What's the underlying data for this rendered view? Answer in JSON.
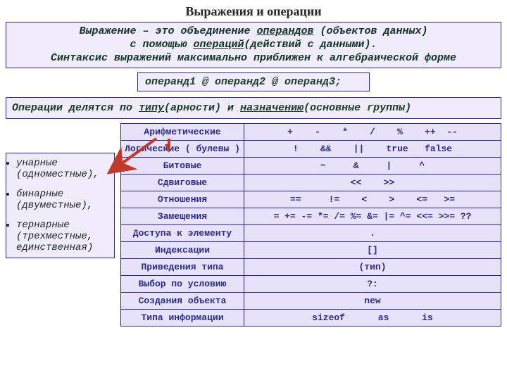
{
  "title": "Выражения и операции",
  "definition": {
    "line1_pre": "Выражение – это объединение ",
    "line1_u": "операндов",
    "line1_post": " (объектов данных)",
    "line2_pre": "с помощью ",
    "line2_u": "операций",
    "line2_post": "(действий с данными).",
    "line3": "Синтаксис выражений максимально приближен к алгебраической форме"
  },
  "syntax": "операнд1 @ операнд2 @ операнд3;",
  "types": {
    "pre1": "Операции  делятся по ",
    "u1": "типу",
    "mid1": "(арности) и ",
    "u2": "назначению",
    "post1": "(основные группы)"
  },
  "arity": {
    "items": [
      {
        "main": "унарные",
        "sub": "(одноместные),"
      },
      {
        "main": "бинарные",
        "sub": "(двуместные),"
      },
      {
        "main": "тернарные",
        "sub": "(трехместные, единственная)"
      }
    ]
  },
  "table": [
    {
      "cat": "Арифметические",
      "ops": "+    -    *    /    %    ++  --"
    },
    {
      "cat": "Логические ( булевы )",
      "ops": "!    &&    ||    true   false"
    },
    {
      "cat": "Битовые",
      "ops": "~     &     |     ^"
    },
    {
      "cat": "Сдвиговые",
      "ops": "<<    >>"
    },
    {
      "cat": "Отношения",
      "ops": "==     !=    <    >    <=   >="
    },
    {
      "cat": "Замещения",
      "ops": "= += -= *= /= %= &= |= ^= <<= >>= ??"
    },
    {
      "cat": "Доступа к элементу",
      "ops": "."
    },
    {
      "cat": "Индексации",
      "ops": "[]"
    },
    {
      "cat": "Приведения типа",
      "ops": "(тип)"
    },
    {
      "cat": "Выбор по условию",
      "ops": "?:"
    },
    {
      "cat": "Создания объекта",
      "ops": "new"
    },
    {
      "cat": "Типа информации",
      "ops": "sizeof      as      is"
    }
  ]
}
